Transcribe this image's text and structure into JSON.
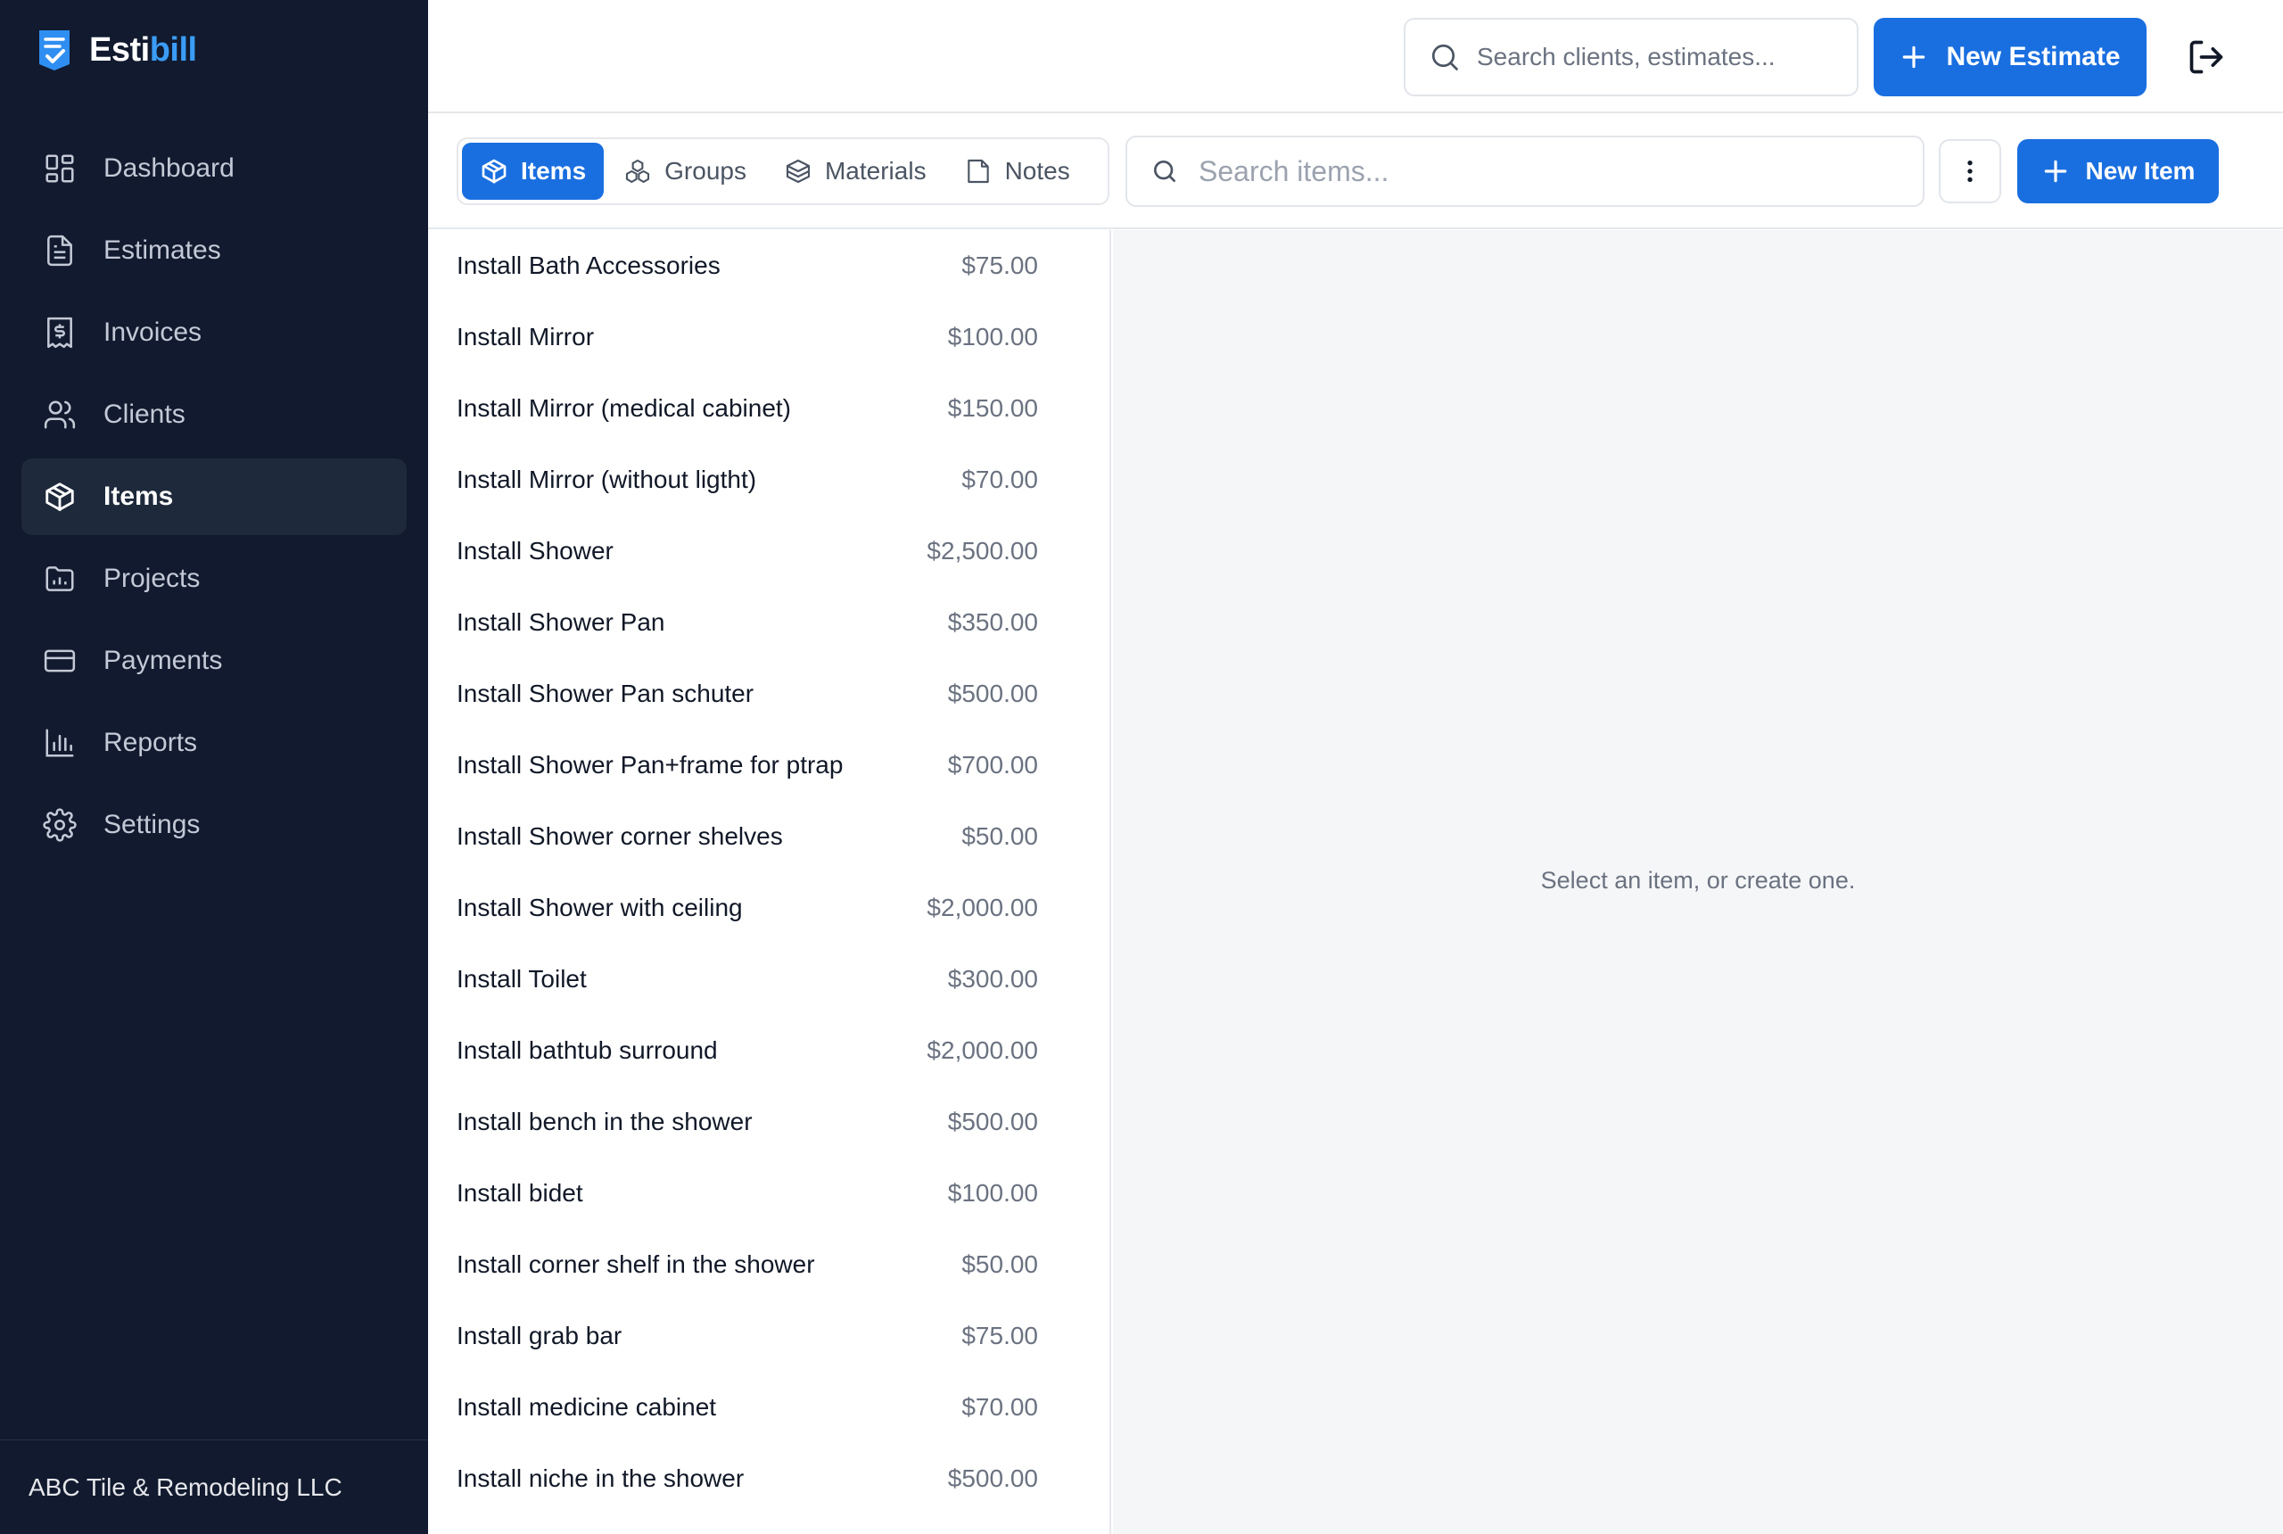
{
  "app": {
    "logo_main": "Esti",
    "logo_accent": "bill",
    "accent_color": "#1a6fe0",
    "sidebar_bg": "#111a2e"
  },
  "sidebar": {
    "items": [
      {
        "label": "Dashboard",
        "icon": "dashboard-icon"
      },
      {
        "label": "Estimates",
        "icon": "document-icon"
      },
      {
        "label": "Invoices",
        "icon": "invoice-icon"
      },
      {
        "label": "Clients",
        "icon": "users-icon"
      },
      {
        "label": "Items",
        "icon": "box-icon",
        "active": true
      },
      {
        "label": "Projects",
        "icon": "folder-chart-icon"
      },
      {
        "label": "Payments",
        "icon": "credit-card-icon"
      },
      {
        "label": "Reports",
        "icon": "bar-chart-icon"
      },
      {
        "label": "Settings",
        "icon": "gear-icon"
      }
    ],
    "company": "ABC Tile & Remodeling LLC"
  },
  "header": {
    "search_placeholder": "Search clients, estimates...",
    "new_estimate_label": "New Estimate"
  },
  "toolbar": {
    "tabs": [
      {
        "label": "Items",
        "icon": "box-icon",
        "active": true
      },
      {
        "label": "Groups",
        "icon": "boxes-icon"
      },
      {
        "label": "Materials",
        "icon": "layers-box-icon"
      },
      {
        "label": "Notes",
        "icon": "note-icon"
      }
    ],
    "search_placeholder": "Search items...",
    "new_item_label": "New Item"
  },
  "items": [
    {
      "name": "Install Bath Accessories",
      "price": "$75.00"
    },
    {
      "name": "Install Mirror",
      "price": "$100.00"
    },
    {
      "name": "Install Mirror (medical cabinet)",
      "price": "$150.00"
    },
    {
      "name": "Install Mirror (without ligtht)",
      "price": "$70.00"
    },
    {
      "name": "Install Shower",
      "price": "$2,500.00"
    },
    {
      "name": "Install Shower Pan",
      "price": "$350.00"
    },
    {
      "name": "Install Shower Pan schuter",
      "price": "$500.00"
    },
    {
      "name": "Install Shower Pan+frame for ptrap",
      "price": "$700.00"
    },
    {
      "name": "Install Shower corner shelves",
      "price": "$50.00"
    },
    {
      "name": "Install Shower with ceiling",
      "price": "$2,000.00"
    },
    {
      "name": "Install Toilet",
      "price": "$300.00"
    },
    {
      "name": "Install bathtub surround",
      "price": "$2,000.00"
    },
    {
      "name": "Install bench in the shower",
      "price": "$500.00"
    },
    {
      "name": "Install bidet",
      "price": "$100.00"
    },
    {
      "name": "Install corner shelf in the shower",
      "price": "$50.00"
    },
    {
      "name": "Install grab bar",
      "price": "$75.00"
    },
    {
      "name": "Install medicine cabinet",
      "price": "$70.00"
    },
    {
      "name": "Install niche in the shower",
      "price": "$500.00"
    }
  ],
  "detail": {
    "empty_message": "Select an item, or create one."
  }
}
